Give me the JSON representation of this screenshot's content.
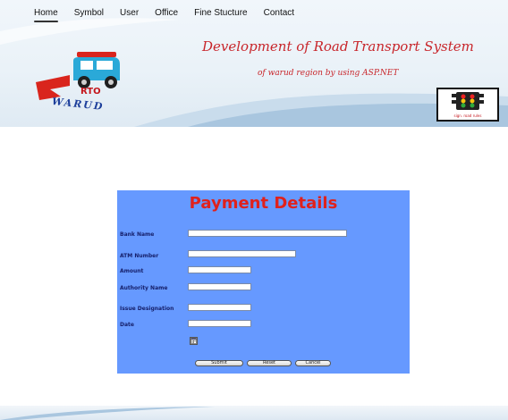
{
  "nav": {
    "items": [
      {
        "label": "Home",
        "active": true
      },
      {
        "label": "Symbol",
        "active": false
      },
      {
        "label": "User",
        "active": false
      },
      {
        "label": "Office",
        "active": false
      },
      {
        "label": "Fine Stucture",
        "active": false
      },
      {
        "label": "Contact",
        "active": false
      }
    ]
  },
  "header": {
    "title": "Development of Road Transport System",
    "subtitle": "of warud region by using ASP.NET",
    "logo_text": "RTO",
    "logo_place": "WARUD",
    "signal_caption": "sign. road rules"
  },
  "form": {
    "title": "Payment Details",
    "fields": {
      "bank_name": {
        "label": "Bank Name",
        "value": ""
      },
      "atm_number": {
        "label": "ATM Number",
        "value": ""
      },
      "amount": {
        "label": "Amount",
        "value": ""
      },
      "authority_name": {
        "label": "Authority Name",
        "value": ""
      },
      "issue_designation": {
        "label": "Issue Designation",
        "value": ""
      },
      "date": {
        "label": "Date",
        "value": ""
      }
    },
    "buttons": {
      "submit": "Submit",
      "reset": "Reset",
      "cancel": "Cancel"
    }
  },
  "colors": {
    "panel_bg": "#6699ff",
    "title_red": "#e0211c",
    "label_navy": "#16206b",
    "header_red": "#c8262b"
  },
  "icons": {
    "calendar": "calendar-icon",
    "traffic_signal": "traffic-light-icon"
  }
}
